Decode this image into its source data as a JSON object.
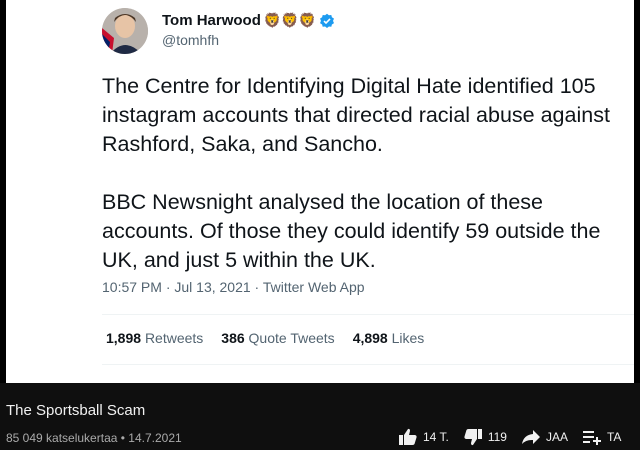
{
  "tweet": {
    "author_name": "Tom Harwood",
    "author_emoji": "🦁🦁🦁",
    "handle": "@tomhfh",
    "paragraphs": [
      "The Centre for Identifying Digital Hate identified 105 instagram accounts that directed racial abuse against Rashford, Saka, and Sancho.",
      "BBC Newsnight analysed the location of these accounts. Of those they could identify 59 outside the UK, and just 5 within the UK."
    ],
    "meta": "10:57 PM · Jul 13, 2021 · Twitter Web App",
    "stats": {
      "retweets_count": "1,898",
      "retweets_label": "Retweets",
      "quotes_count": "386",
      "quotes_label": "Quote Tweets",
      "likes_count": "4,898",
      "likes_label": "Likes"
    },
    "verified_color": "#1d9bf0"
  },
  "video": {
    "title": "The Sportsball Scam",
    "subtitle": "85 049 katselukertaa • 14.7.2021",
    "like_count": "14 T.",
    "dislike_count": "119",
    "share_label": "JAA",
    "save_label": "TA"
  }
}
